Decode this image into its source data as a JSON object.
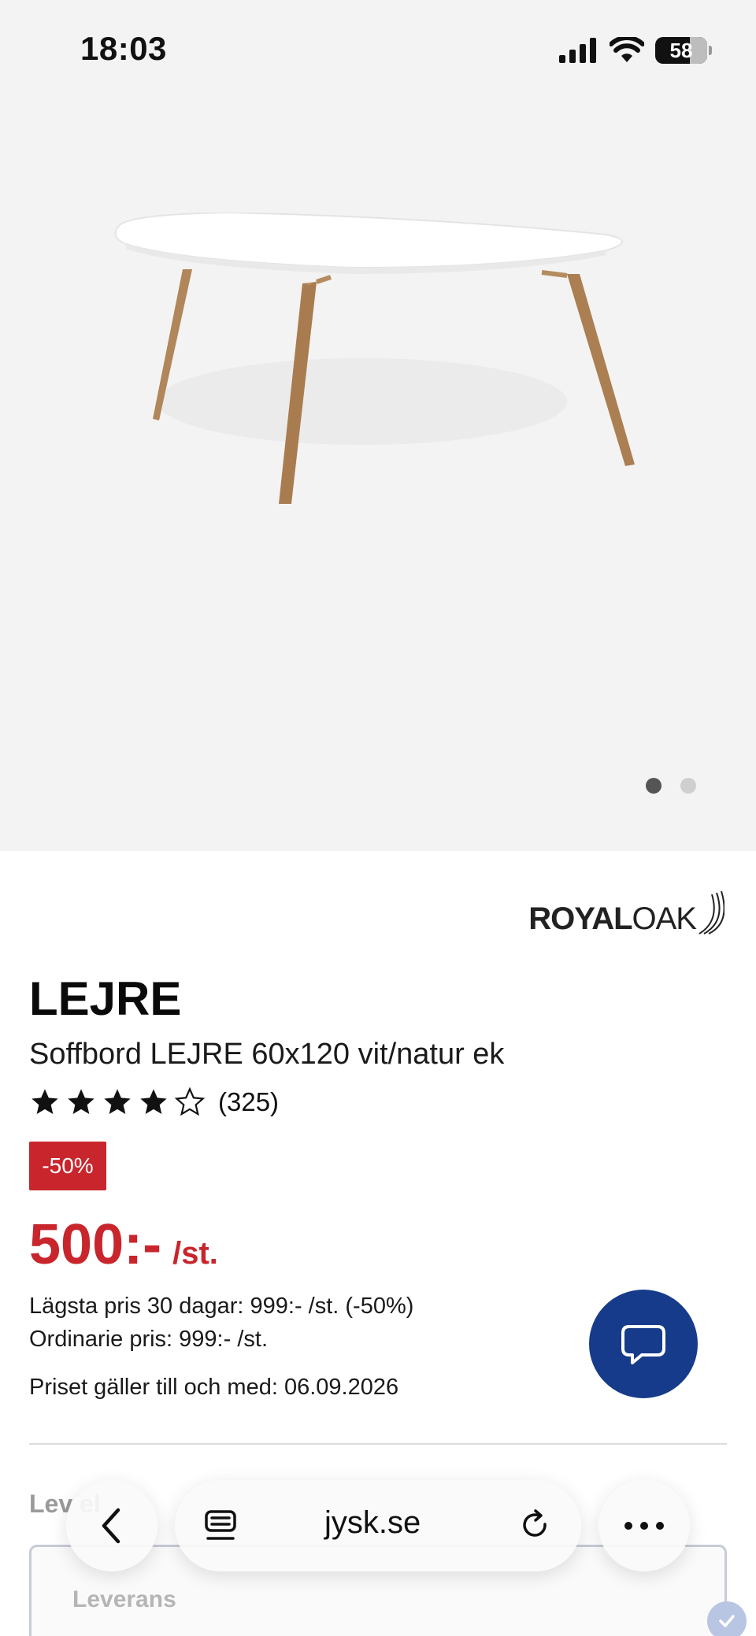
{
  "status_bar": {
    "time": "18:03",
    "battery_level": "58",
    "icons": [
      "signal-icon",
      "wifi-icon",
      "battery-icon"
    ]
  },
  "gallery": {
    "image": "coffee-table-image",
    "page_count": 2,
    "active_page": 1
  },
  "brand": {
    "logo_text_bold": "ROYAL",
    "logo_text_light": "OAK"
  },
  "product": {
    "name": "LEJRE",
    "subtitle": "Soffbord LEJRE 60x120 vit/natur ek",
    "rating": 4,
    "rating_max": 5,
    "review_count": "(325)",
    "discount_badge": "-50%",
    "price": "500:-",
    "price_unit": "/st.",
    "lowest_price_line": "Lägsta pris 30 dagar: 999:- /st. (-50%)",
    "ordinary_price_line": "Ordinarie pris: 999:- /st.",
    "valid_until_line": "Priset gäller till och med: 06.09.2026"
  },
  "delivery": {
    "heading": "Lev          el",
    "box_label": "Leverans"
  },
  "browser": {
    "url": "jysk.se"
  },
  "colors": {
    "sale_red": "#c9252c",
    "chat_blue": "#163b8b",
    "image_bg": "#f3f3f3"
  }
}
